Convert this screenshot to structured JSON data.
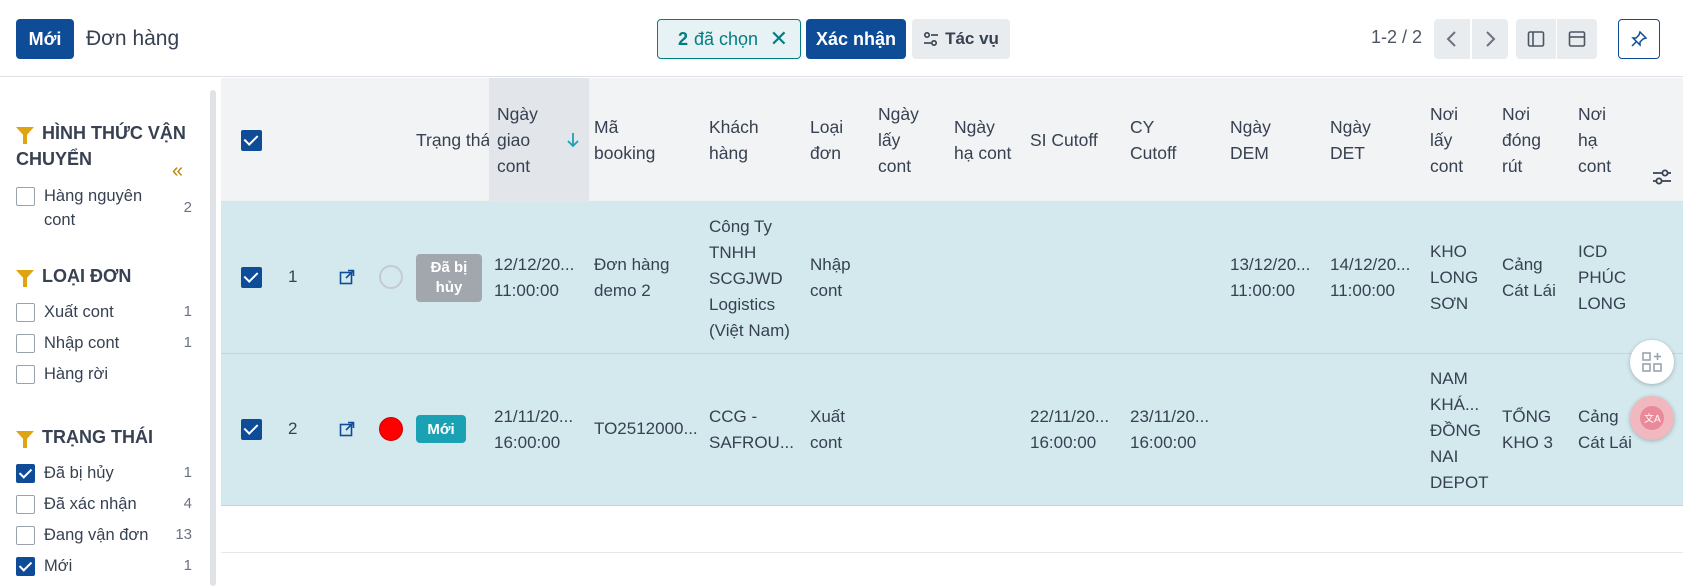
{
  "header": {
    "new_label": "Mới",
    "title": "Đơn hàng",
    "selected_count": "2",
    "selected_text": "đã chọn",
    "confirm_label": "Xác nhận",
    "actions_label": "Tác vụ",
    "pager": "1-2 / 2"
  },
  "sidebar": {
    "sections": [
      {
        "title_line1": "HÌNH THỨC VẬN",
        "title_line2": "CHUYỂN",
        "items": [
          {
            "label": "Hàng nguyên cont",
            "count": "2",
            "checked": false
          }
        ]
      },
      {
        "title_line1": "LOẠI ĐƠN",
        "items": [
          {
            "label": "Xuất cont",
            "count": "1",
            "checked": false
          },
          {
            "label": "Nhập cont",
            "count": "1",
            "checked": false
          },
          {
            "label": "Hàng rời",
            "count": "",
            "checked": false
          }
        ]
      },
      {
        "title_line1": "TRẠNG THÁI",
        "items": [
          {
            "label": "Đã bị hủy",
            "count": "1",
            "checked": true
          },
          {
            "label": "Đã xác nhận",
            "count": "4",
            "checked": false
          },
          {
            "label": "Đang vận đơn",
            "count": "13",
            "checked": false
          },
          {
            "label": "Mới",
            "count": "1",
            "checked": true
          }
        ]
      }
    ]
  },
  "table": {
    "headers": [
      "Trạng thái",
      "Ngày giao cont",
      "Mã booking",
      "Khách hàng",
      "Loại đơn",
      "Ngày lấy cont",
      "Ngày hạ cont",
      "SI Cutoff",
      "CY Cutoff",
      "Ngày DEM",
      "Ngày DET",
      "Nơi lấy cont",
      "Nơi đóng rút",
      "Nơi hạ cont"
    ],
    "rows": [
      {
        "num": "1",
        "status": "Đã bị hủy",
        "dot_color": "#f1f3f5",
        "ngay_giao": [
          "12/12/20...",
          "11:00:00"
        ],
        "booking": [
          "Đơn hàng",
          "demo 2"
        ],
        "khach_hang": [
          "Công Ty",
          "TNHH",
          "SCGJWD",
          "Logistics",
          "(Việt Nam)"
        ],
        "loai_don": [
          "Nhập",
          "cont"
        ],
        "si_cutoff": [
          "",
          ""
        ],
        "cy_cutoff": [
          "",
          ""
        ],
        "dem": [
          "13/12/20...",
          "11:00:00"
        ],
        "det": [
          "14/12/20...",
          "11:00:00"
        ],
        "noi_lay": [
          "KHO",
          "LONG",
          "SƠN"
        ],
        "noi_dong": [
          "Cảng",
          "Cát Lái"
        ],
        "noi_ha": [
          "ICD",
          "PHÚC",
          "LONG"
        ]
      },
      {
        "num": "2",
        "status": "Mới",
        "dot_color": "#ff0000",
        "ngay_giao": [
          "21/11/20...",
          "16:00:00"
        ],
        "booking": [
          "TO2512000..."
        ],
        "khach_hang": [
          "CCG -",
          "SAFROU..."
        ],
        "loai_don": [
          "Xuất",
          "cont"
        ],
        "si_cutoff": [
          "22/11/20...",
          "16:00:00"
        ],
        "cy_cutoff": [
          "23/11/20...",
          "16:00:00"
        ],
        "dem": [
          "",
          ""
        ],
        "det": [
          "",
          ""
        ],
        "noi_lay": [
          "NAM",
          "KHÁ...",
          "ĐỒNG",
          "NAI",
          "DEPOT"
        ],
        "noi_dong": [
          "TỔNG",
          "KHO 3"
        ],
        "noi_ha": [
          "Cảng",
          "Cát Lái"
        ]
      }
    ]
  },
  "colors": {
    "primary": "#0f4c98",
    "teal": "#017e84",
    "row_selected": "#d3e9ee",
    "filter_icon": "#e0a410"
  }
}
